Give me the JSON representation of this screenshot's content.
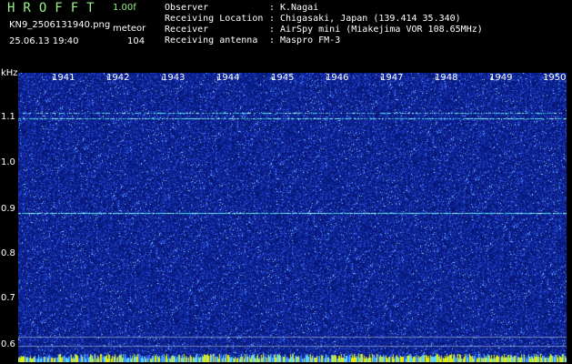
{
  "header": {
    "app_title": "HROFFT",
    "version": "1.00f",
    "filename": "KN9_2506131940.png",
    "mode": "meteor",
    "datetime": "25.06.13 19:40",
    "count": "104"
  },
  "info": [
    {
      "label": "Observer",
      "value": "K.Nagai"
    },
    {
      "label": "Receiving Location",
      "value": "Chigasaki, Japan (139.414 35.340)"
    },
    {
      "label": "Receiver",
      "value": "AirSpy mini (Miakejima VOR 108.65MHz)"
    },
    {
      "label": "Receiving antenna",
      "value": "Maspro FM-3"
    }
  ],
  "info_separator": ":",
  "spectrogram": {
    "y_unit": "kHz",
    "y_ticks": [
      "1.1",
      "1.0",
      "0.9",
      "0.8",
      "0.7",
      "0.6"
    ],
    "time_labels": [
      "1941",
      "1942",
      "1943",
      "1944",
      "1945",
      "1946",
      "1947",
      "1948",
      "1949",
      "1950"
    ],
    "colors": {
      "background": "#0a1f8c",
      "noise_light": "#3a5cff",
      "signal": "#40e0e8",
      "bottom_strip": "#e8f000"
    }
  }
}
